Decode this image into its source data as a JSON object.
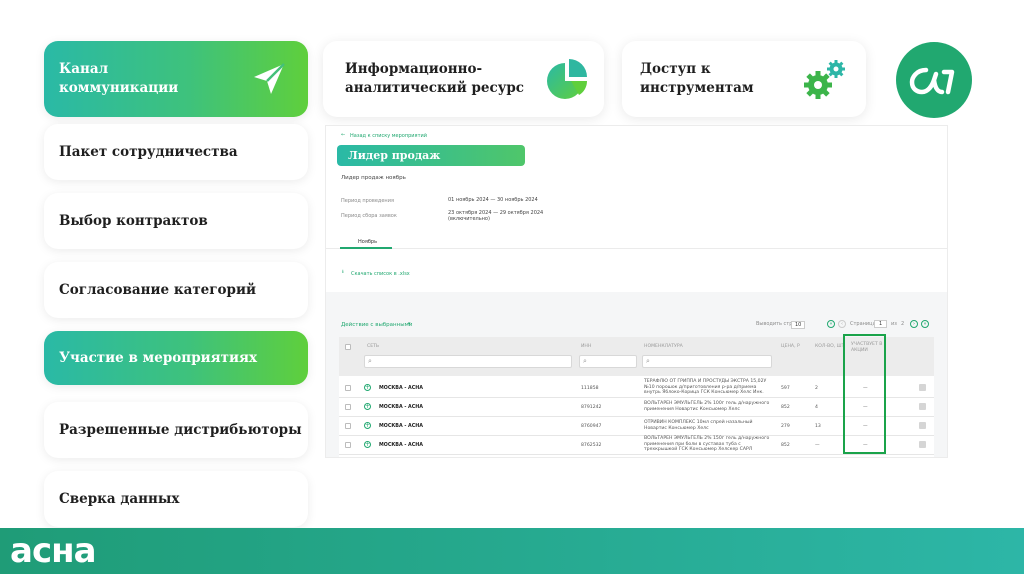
{
  "menu": {
    "items": [
      {
        "label": "Канал\nкоммуникации",
        "active": true
      },
      {
        "label": "Пакет сотрудничества",
        "active": false
      },
      {
        "label": "Выбор контрактов",
        "active": false
      },
      {
        "label": "Согласование категорий",
        "active": false
      },
      {
        "label": "Участие в мероприятиях",
        "active": true
      },
      {
        "label": "Разрешенные дистрибьюторы",
        "active": false
      },
      {
        "label": "Сверка данных",
        "active": false
      }
    ]
  },
  "top_cards": {
    "analytics": "Информационно-\nаналитический ресурс",
    "tools": "Доступ к\nинструментам"
  },
  "brand": {
    "footer_logo": "асна",
    "circle_logo": "асна-mark"
  },
  "colors": {
    "accent_green": "#21a870",
    "gradient_start": "#2ab9a6",
    "gradient_end": "#5fcf3c",
    "highlight": "#1aa34a"
  },
  "screen": {
    "back_link": "Назад к списку мероприятий",
    "event_title": "Лидер продаж",
    "event_subtitle": "Лидер продаж ноябрь",
    "period_label": "Период проведения",
    "period_value": "01 ноябрь 2024 — 30 ноябрь 2024",
    "collection_label": "Период сбора заявок",
    "collection_value": "23 октября 2024 — 29 октября 2024",
    "collection_note": "(включительно)",
    "tab": "Ноябрь",
    "download_link": "Скачать список в .xlsx",
    "actions_dropdown": "Действие с выбранными",
    "show_by_label": "Выводить строк",
    "show_by_value": "10",
    "page_label": "Страница",
    "page_value": "1",
    "page_of": "из",
    "page_total": "2",
    "columns": [
      "Сеть",
      "ИНН",
      "Номенклатура",
      "Цена, р",
      "Кол-во, шт",
      "Участвует в акции"
    ],
    "rows": [
      {
        "chain": "МОСКВА - АСНА",
        "inn": "111858",
        "product": "ТЕРАФЛЮ ОТ ГРИППА И ПРОСТУДЫ ЭКСТРА 15,02У №10 порошок д/приготовления р-ра д/приема внутрь Яблоко-Корица ГСК Консьюмер Хелс Инк.",
        "price": "597",
        "qty": "2",
        "participates": "—"
      },
      {
        "chain": "МОСКВА - АСНА",
        "inn": "8791242",
        "product": "ВОЛЬТАРЕН ЭМУЛЬГЕЛЬ 2% 100г гель д/наружного применения Новартис Консьюмер Хелс",
        "price": "852",
        "qty": "4",
        "participates": "—"
      },
      {
        "chain": "МОСКВА - АСНА",
        "inn": "8760947",
        "product": "ОТРИВИН КОМПЛЕКС 10мл спрей назальный Новартис Консьюмер Хелс",
        "price": "279",
        "qty": "13",
        "participates": "—"
      },
      {
        "chain": "МОСКВА - АСНА",
        "inn": "8762532",
        "product": "ВОЛЬТАРЕН ЭМУЛЬГЕЛЬ 2% 150г гель д/наружного применения при боли в суставах туба с трехкрышкой ГСК Консьюмер Хелскер САРЛ",
        "price": "852",
        "qty": "—",
        "participates": "—"
      }
    ]
  }
}
